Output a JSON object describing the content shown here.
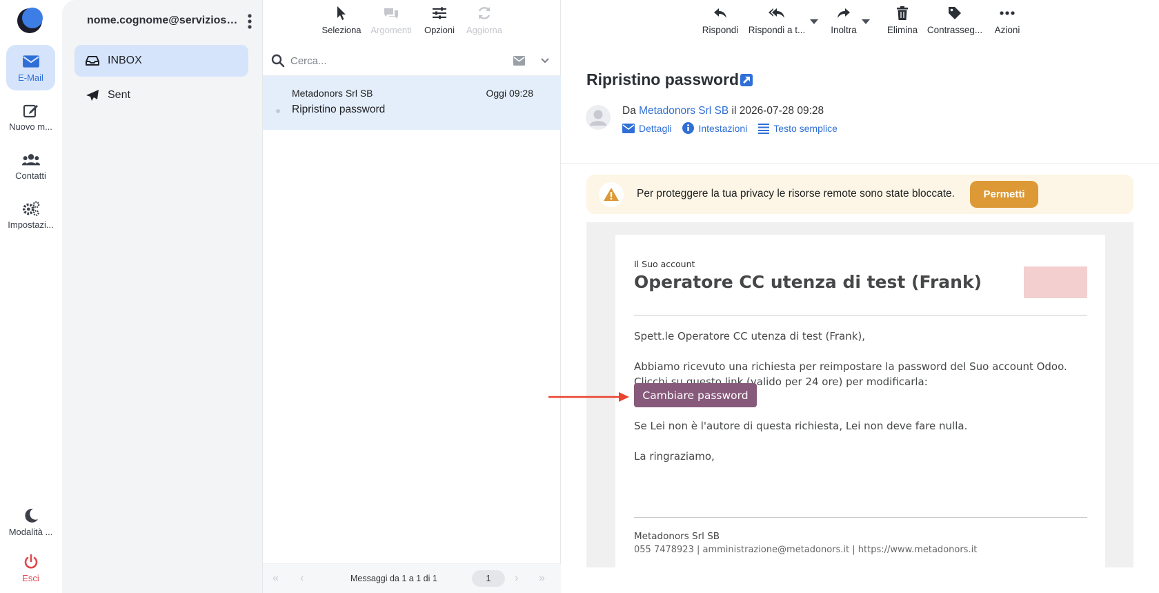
{
  "account": {
    "email": "nome.cognome@serviziosost..."
  },
  "rail": {
    "email": "E-Mail",
    "compose": "Nuovo m...",
    "contacts": "Contatti",
    "settings": "Impostazi...",
    "theme": "Modalità ...",
    "logout": "Esci"
  },
  "folders": [
    {
      "label": "INBOX"
    },
    {
      "label": "Sent"
    }
  ],
  "list_toolbar": {
    "select": "Seleziona",
    "threads": "Argomenti",
    "options": "Opzioni",
    "refresh": "Aggiorna"
  },
  "search": {
    "placeholder": "Cerca..."
  },
  "messages": [
    {
      "from": "Metadonors Srl SB",
      "date": "Oggi 09:28",
      "subject": "Ripristino password"
    }
  ],
  "pager": {
    "info": "Messaggi da 1 a 1 di 1",
    "page": "1"
  },
  "reader_toolbar": {
    "reply": "Rispondi",
    "reply_all": "Rispondi a t...",
    "forward": "Inoltra",
    "delete": "Elimina",
    "flag": "Contrasseg...",
    "actions": "Azioni"
  },
  "message": {
    "subject": "Ripristino password",
    "from_prefix": "Da",
    "from_name": "Metadonors Srl SB",
    "date_text": "il 2026-07-28 09:28",
    "links": {
      "details": "Dettagli",
      "headers": "Intestazioni",
      "plain": "Testo semplice"
    },
    "privacy_text": "Per proteggere la tua privacy le risorse remote sono state bloccate.",
    "privacy_allow": "Permetti"
  },
  "email_body": {
    "kicker": "Il Suo account",
    "name": "Operatore CC utenza di test (Frank)",
    "greeting": "Spett.le Operatore CC utenza di test (Frank),",
    "para1": "Abbiamo ricevuto una richiesta per reimpostare la password del Suo account Odoo. Clicchi su questo link (valido per 24 ore) per modificarla:",
    "cta": "Cambiare password",
    "para2": "Se Lei non è l'autore di questa richiesta, Lei non deve fare nulla.",
    "closing": "La ringraziamo,",
    "footer_company": "Metadonors Srl SB",
    "footer_contacts": "055 7478923 | amministrazione@metadonors.it | https://www.metadonors.it"
  },
  "colors": {
    "accent": "#2f6fd6",
    "allow_button": "#dc9936",
    "cta_button": "#875a7b",
    "annotation_arrow": "#e8442f"
  }
}
